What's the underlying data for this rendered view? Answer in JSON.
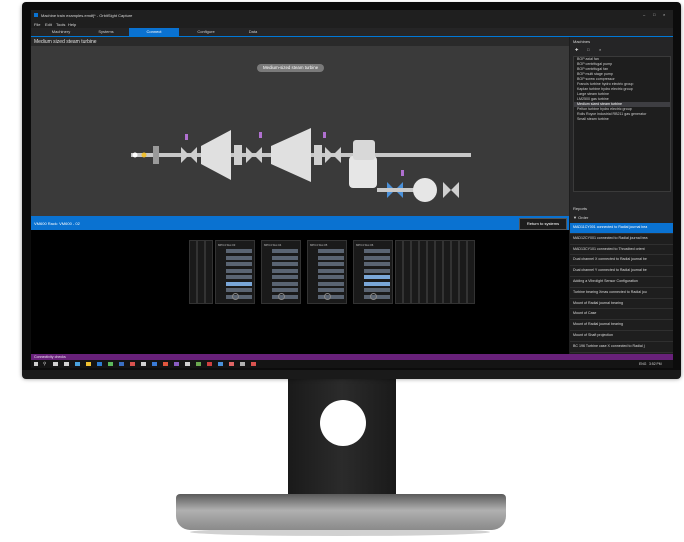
{
  "window": {
    "title": "Machine train examples.emdfj* - OrbitSight Capture"
  },
  "menu": [
    "File",
    "Edit",
    "Tools",
    "Help"
  ],
  "tabs": [
    {
      "label": "Machinery",
      "active": false
    },
    {
      "label": "Systems",
      "active": false
    },
    {
      "label": "Connect",
      "active": true
    },
    {
      "label": "Configure",
      "active": false
    },
    {
      "label": "Data",
      "active": false
    }
  ],
  "view": {
    "heading": "Medium sized steam turbine",
    "diagram_label": "Medium-sized steam turbine"
  },
  "machines_panel": {
    "title": "Machines",
    "items": [
      {
        "label": "BOP axial fan",
        "selected": false
      },
      {
        "label": "BOP centrifugal pump",
        "selected": false
      },
      {
        "label": "BOP centrifugal fan",
        "selected": false
      },
      {
        "label": "BOP multi stage pump",
        "selected": false
      },
      {
        "label": "BOP screw compressor",
        "selected": false
      },
      {
        "label": "Francis turbine hydro electric group",
        "selected": false
      },
      {
        "label": "Kaplan turbine hydro electric group",
        "selected": false
      },
      {
        "label": "Large steam turbine",
        "selected": false
      },
      {
        "label": "LM2500 gas turbine",
        "selected": false
      },
      {
        "label": "Medium sized steam turbine",
        "selected": true
      },
      {
        "label": "Pelton turbine hydro electric group",
        "selected": false
      },
      {
        "label": "Rolls Royce industrial RB211 gas generator",
        "selected": false
      },
      {
        "label": "Small steam turbine",
        "selected": false
      }
    ]
  },
  "reports_panel": {
    "title": "Reports",
    "filter_label": "Order",
    "items": [
      {
        "label": "MAD11CY001 connected to Radial journal bea",
        "selected": true
      },
      {
        "label": "MAD12CY001 connected to Radial journal bea",
        "selected": false
      },
      {
        "label": "MAD13CY101 connected to Thrustbed orient",
        "selected": false
      },
      {
        "label": "Dual channel X connected to Radial journal be",
        "selected": false
      },
      {
        "label": "Dual channel Y connected to Radial journal be",
        "selected": false
      },
      {
        "label": "Adding a Vibrolight Sensor Configuration",
        "selected": false
      },
      {
        "label": "Turbine bearing Xmas connected to Radial jou",
        "selected": false
      },
      {
        "label": "Mount of Radial journal bearing",
        "selected": false
      },
      {
        "label": "Mount of Case",
        "selected": false
      },
      {
        "label": "Mount of Radial journal bearing",
        "selected": false
      },
      {
        "label": "Mount of Shaft projection",
        "selected": false
      },
      {
        "label": "BC 196 Turbine case X connected to Radial j",
        "selected": false
      }
    ]
  },
  "connect_bar": {
    "label": "VM600 Rack: VM600 - 02",
    "return_button": "Return to systems"
  },
  "cards": [
    {
      "title": "MPC4 Slot 03"
    },
    {
      "title": "MPC4 Slot 04"
    },
    {
      "title": "MPC4 Slot 05"
    },
    {
      "title": "MPC4 Slot 06"
    }
  ],
  "status": {
    "text": "Connectivity checks"
  },
  "taskbar": {
    "clock": "3:52 PM",
    "lang": "ENG"
  },
  "colors": {
    "accent": "#0a72d1",
    "status_bar": "#68217a",
    "background": "#1e1e1e"
  }
}
